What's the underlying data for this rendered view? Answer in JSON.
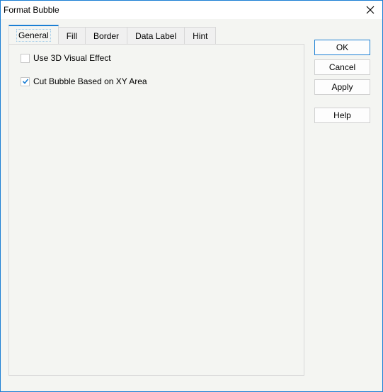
{
  "window": {
    "title": "Format Bubble",
    "close_icon": "close-icon"
  },
  "tabs": [
    {
      "label": "General",
      "active": true
    },
    {
      "label": "Fill",
      "active": false
    },
    {
      "label": "Border",
      "active": false
    },
    {
      "label": "Data Label",
      "active": false
    },
    {
      "label": "Hint",
      "active": false
    }
  ],
  "general": {
    "options": [
      {
        "label": "Use 3D Visual Effect",
        "checked": false
      },
      {
        "label": "Cut Bubble Based on XY Area",
        "checked": true
      }
    ]
  },
  "buttons": {
    "ok": "OK",
    "cancel": "Cancel",
    "apply": "Apply",
    "help": "Help"
  },
  "colors": {
    "accent": "#1b7fd4",
    "check": "#1b7fd4",
    "background": "#f4f5f2"
  }
}
